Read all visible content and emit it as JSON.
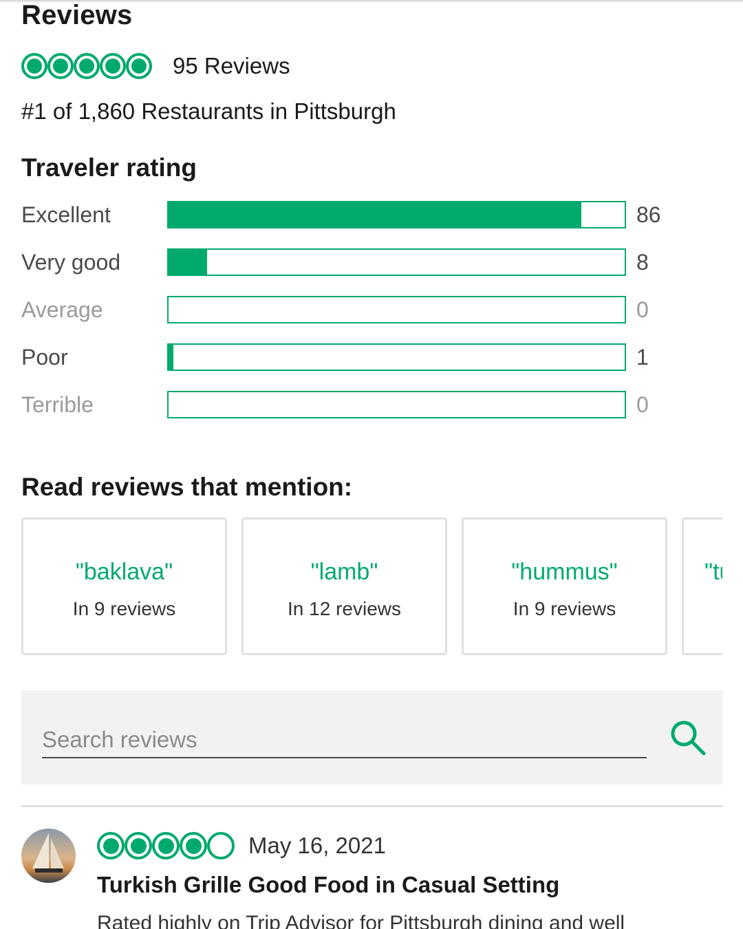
{
  "header": {
    "title": "Reviews",
    "rating_bubbles": 5,
    "reviews_count": "95 Reviews",
    "rank": "#1 of 1,860 Restaurants in Pittsburgh"
  },
  "traveler_rating": {
    "heading": "Traveler rating",
    "rows": [
      {
        "label": "Excellent",
        "count": "86",
        "fraction": 0.905
      },
      {
        "label": "Very good",
        "count": "8",
        "fraction": 0.084
      },
      {
        "label": "Average",
        "count": "0",
        "fraction": 0
      },
      {
        "label": "Poor",
        "count": "1",
        "fraction": 0.011
      },
      {
        "label": "Terrible",
        "count": "0",
        "fraction": 0
      }
    ]
  },
  "mentions": {
    "heading": "Read reviews that mention:",
    "chips": [
      {
        "term": "\"baklava\"",
        "count": "In 9 reviews"
      },
      {
        "term": "\"lamb\"",
        "count": "In 12 reviews"
      },
      {
        "term": "\"hummus\"",
        "count": "In 9 reviews"
      },
      {
        "term": "\"tu",
        "count": ""
      }
    ]
  },
  "search": {
    "placeholder": "Search reviews",
    "icon": "search-icon"
  },
  "review": {
    "rating_bubbles": 4,
    "date": "May 16, 2021",
    "title": "Turkish Grille Good Food in Casual Setting",
    "snippet": "Rated highly on Trip Advisor for Pittsburgh dining and well"
  },
  "colors": {
    "accent": "#00aa6c",
    "search_bg": "#f2f2f2",
    "chip_border": "#e0e0e0"
  }
}
